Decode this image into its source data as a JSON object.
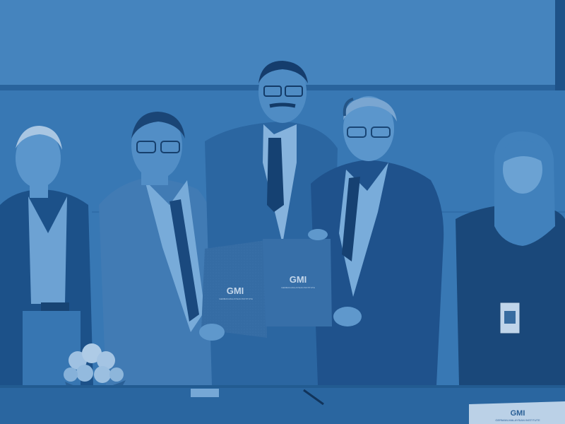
{
  "photo": {
    "tint_color": "#2f6da6",
    "folder_left": {
      "logo": "GMI",
      "subtitle": "GERMAN-MALAYSIAN INSTITUTE"
    },
    "folder_right": {
      "logo": "GMI",
      "subtitle": "GERMAN-MALAYSIAN INSTITUTE"
    },
    "name_plate": {
      "logo": "GMI",
      "subtitle": "GERMAN-MALAYSIAN INSTITUTE"
    }
  }
}
